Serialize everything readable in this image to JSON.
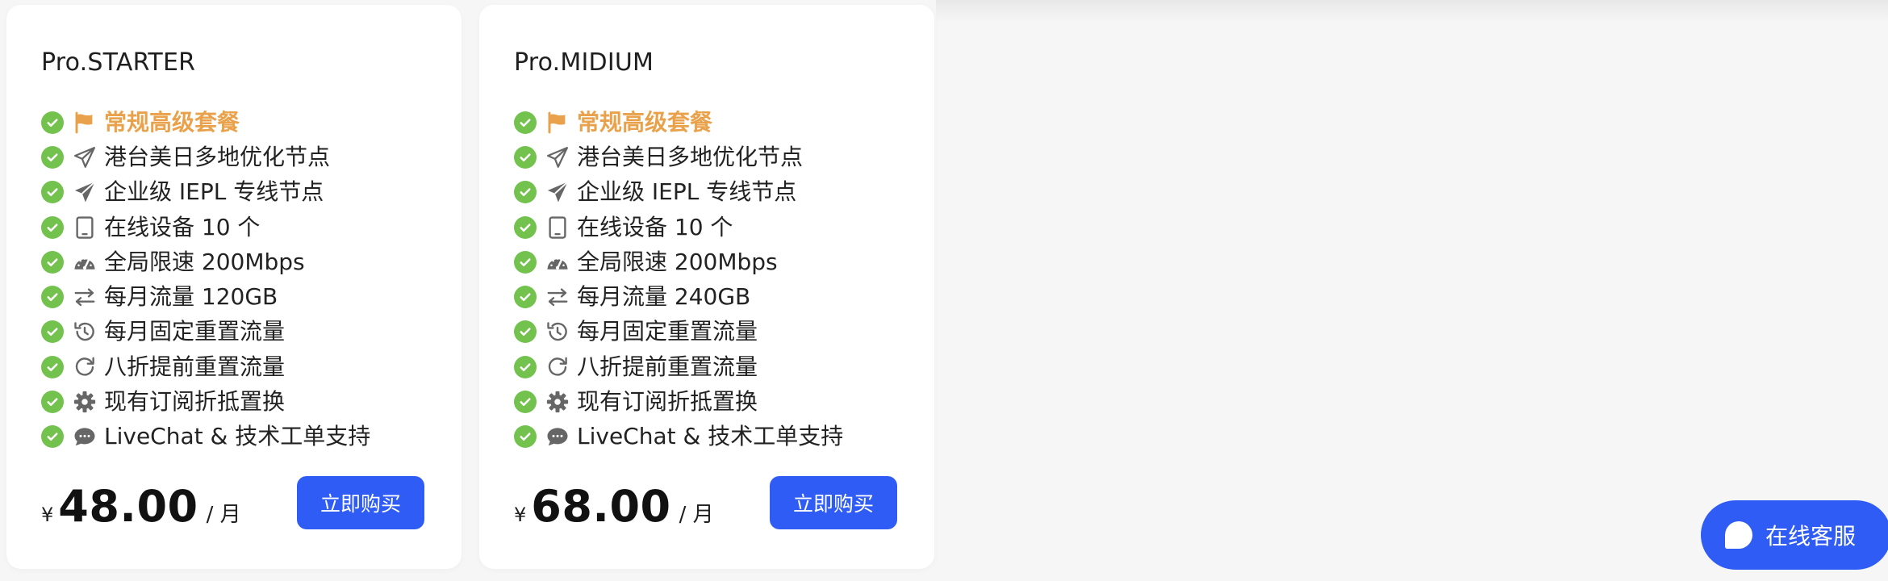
{
  "colors": {
    "accent_blue": "#2f5cf5",
    "check_green": "#72c24d",
    "highlight_orange": "#e9a24b",
    "icon_gray": "#666666"
  },
  "plans": [
    {
      "title": "Pro.STARTER",
      "features": [
        {
          "icon": "flag-icon",
          "text": "常规高级套餐",
          "highlight": true
        },
        {
          "icon": "paper-plane-outline-icon",
          "text": "港台美日多地优化节点"
        },
        {
          "icon": "paper-plane-solid-icon",
          "text": "企业级 IEPL 专线节点"
        },
        {
          "icon": "tablet-icon",
          "text": "在线设备 10 个"
        },
        {
          "icon": "speedometer-icon",
          "text": "全局限速 200Mbps"
        },
        {
          "icon": "exchange-arrows-icon",
          "text": "每月流量 120GB"
        },
        {
          "icon": "history-icon",
          "text": "每月固定重置流量"
        },
        {
          "icon": "redo-icon",
          "text": "八折提前重置流量"
        },
        {
          "icon": "gear-icon",
          "text": "现有订阅折抵置换"
        },
        {
          "icon": "chat-bubble-icon",
          "text": "LiveChat & 技术工单支持"
        }
      ],
      "currency": "¥",
      "price": "48.00",
      "unit": "/ 月",
      "buy_label": "立即购买"
    },
    {
      "title": "Pro.MIDIUM",
      "features": [
        {
          "icon": "flag-icon",
          "text": "常规高级套餐",
          "highlight": true
        },
        {
          "icon": "paper-plane-outline-icon",
          "text": "港台美日多地优化节点"
        },
        {
          "icon": "paper-plane-solid-icon",
          "text": "企业级 IEPL 专线节点"
        },
        {
          "icon": "tablet-icon",
          "text": "在线设备 10 个"
        },
        {
          "icon": "speedometer-icon",
          "text": "全局限速 200Mbps"
        },
        {
          "icon": "exchange-arrows-icon",
          "text": "每月流量 240GB"
        },
        {
          "icon": "history-icon",
          "text": "每月固定重置流量"
        },
        {
          "icon": "redo-icon",
          "text": "八折提前重置流量"
        },
        {
          "icon": "gear-icon",
          "text": "现有订阅折抵置换"
        },
        {
          "icon": "chat-bubble-icon",
          "text": "LiveChat & 技术工单支持"
        }
      ],
      "currency": "¥",
      "price": "68.00",
      "unit": "/ 月",
      "buy_label": "立即购买"
    }
  ],
  "chat_widget": {
    "label": "在线客服"
  }
}
